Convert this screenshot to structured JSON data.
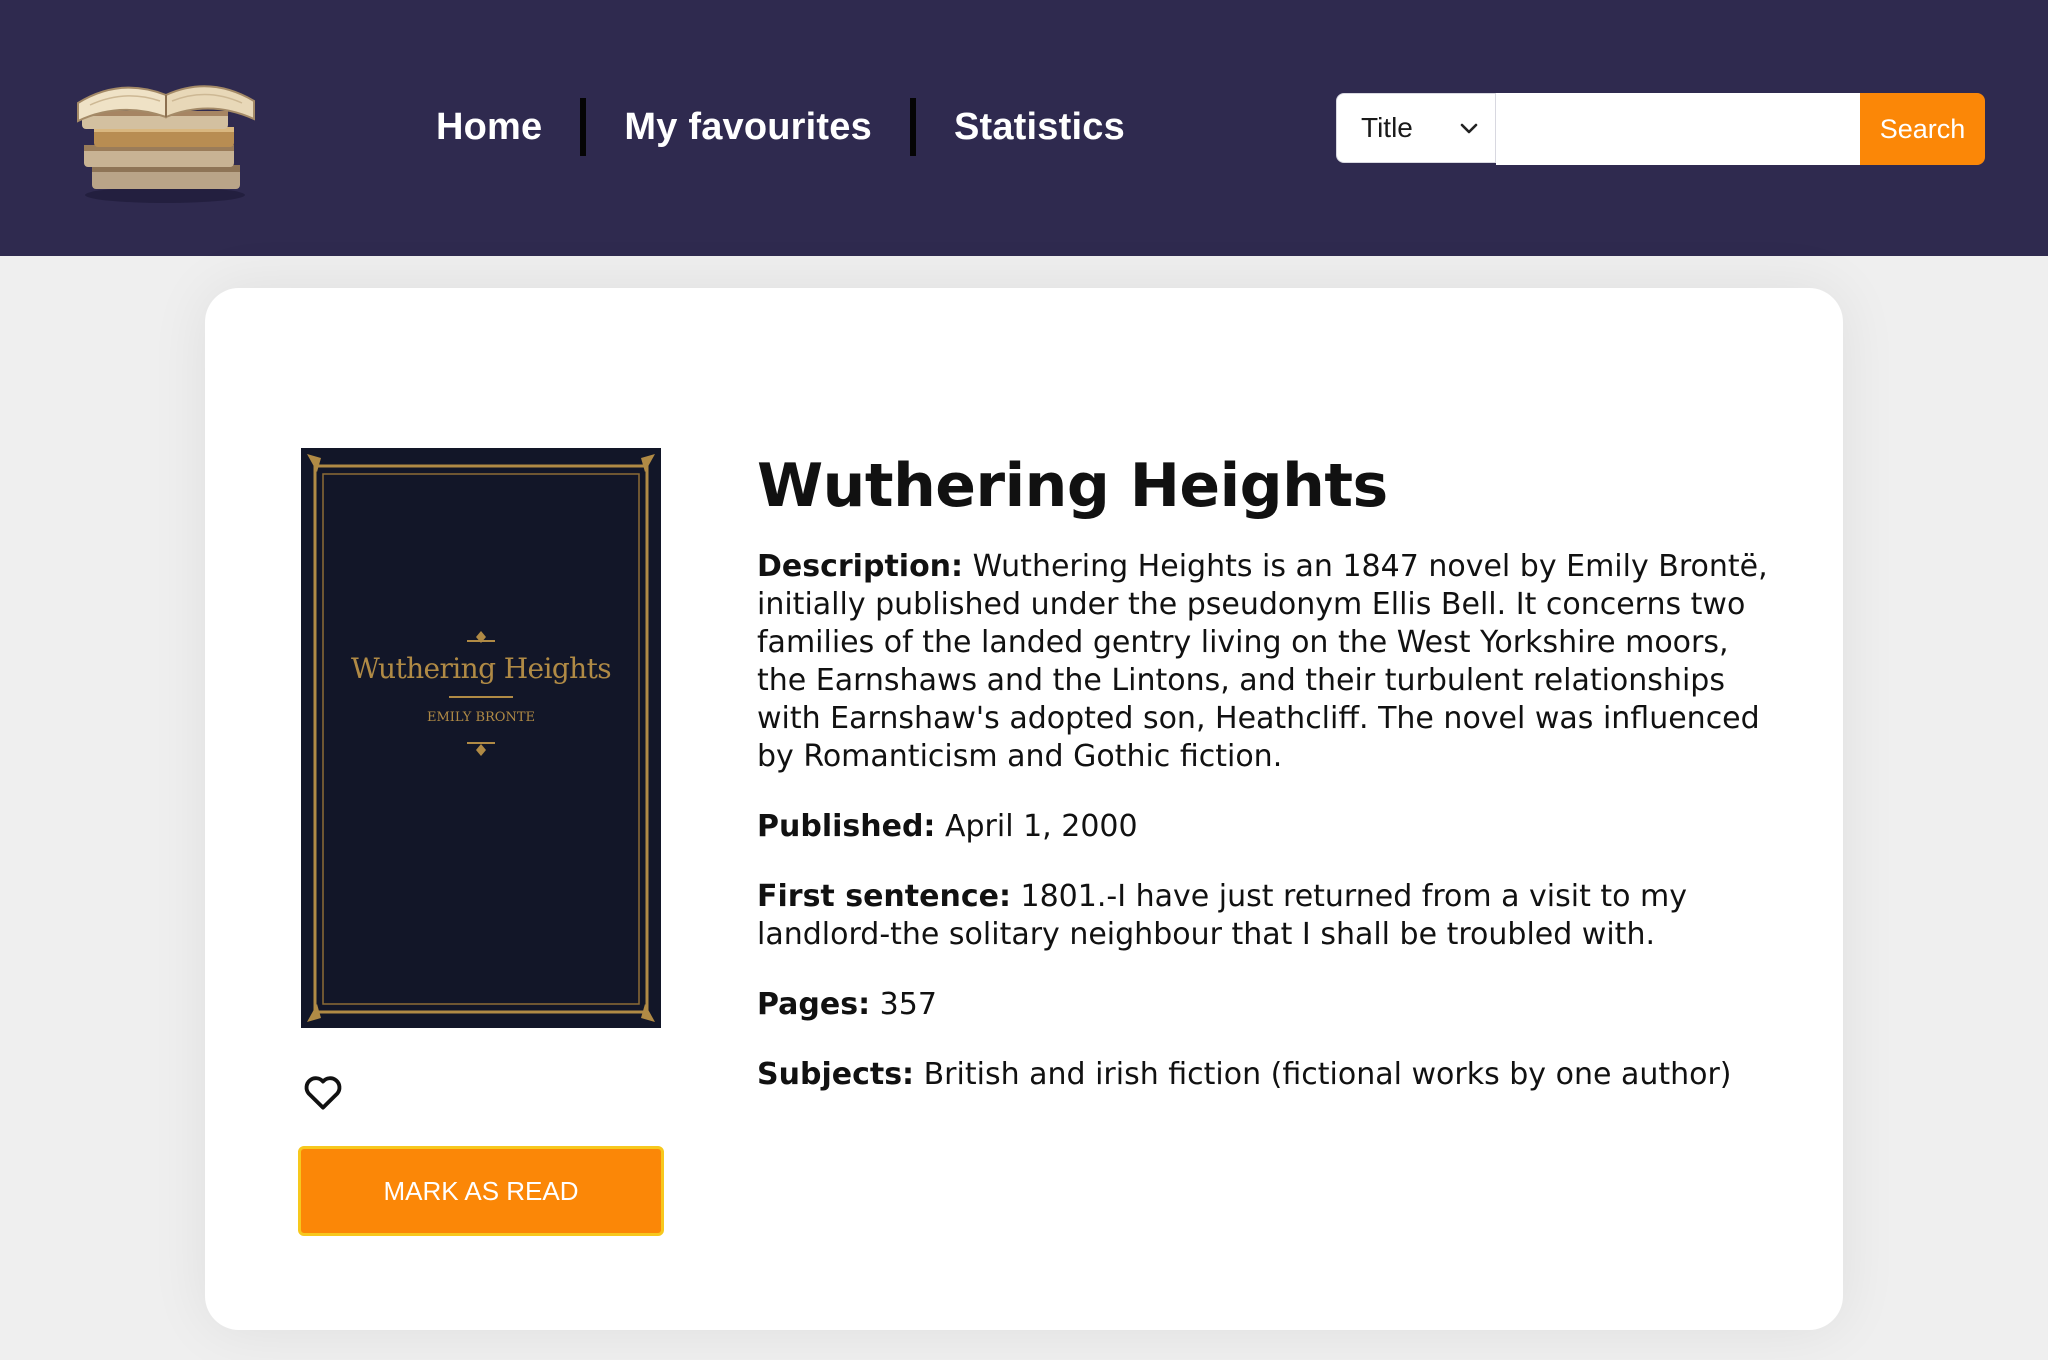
{
  "header": {
    "logo_name": "books-stack-logo",
    "nav": [
      {
        "label": "Home"
      },
      {
        "label": "My favourites"
      },
      {
        "label": "Statistics"
      }
    ],
    "search": {
      "filter_value": "Title",
      "input_value": "",
      "button_label": "Search"
    }
  },
  "book": {
    "title": "Wuthering Heights",
    "cover": {
      "title": "Wuthering Heights",
      "author": "EMILY BRONTE"
    },
    "fields": [
      {
        "label": "Description:",
        "value": "Wuthering Heights is an 1847 novel by Emily Brontë, initially published under the pseudonym Ellis Bell. It concerns two families of the landed gentry living on the West Yorkshire moors, the Earnshaws and the Lintons, and their turbulent relationships with Earnshaw's adopted son, Heathcliff. The novel was influenced by Romanticism and Gothic fiction."
      },
      {
        "label": "Published:",
        "value": "April 1, 2000"
      },
      {
        "label": "First sentence:",
        "value": "1801.-I have just returned from a visit to my landlord-the solitary neighbour that I shall be troubled with."
      },
      {
        "label": "Pages:",
        "value": "357"
      },
      {
        "label": "Subjects:",
        "value": "British and irish fiction (fictional works by one author)"
      }
    ],
    "actions": {
      "favourite_icon": "heart-outline-icon",
      "mark_read_label": "MARK AS READ"
    }
  },
  "colors": {
    "header_bg": "#2f2a4f",
    "accent": "#fb8707",
    "page_bg": "#efefef"
  }
}
